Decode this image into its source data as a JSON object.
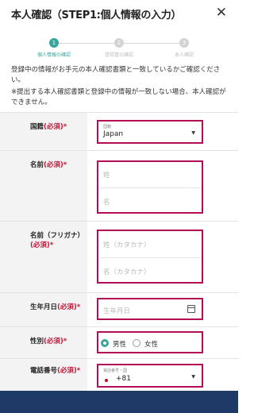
{
  "header": {
    "title": "本人確認（STEP1:個人情報の入力）",
    "close_icon": "close-icon"
  },
  "steps": [
    {
      "number": "1",
      "label": "個人情報の確認",
      "active": true
    },
    {
      "number": "2",
      "label": "登録書の確認",
      "active": false
    },
    {
      "number": "3",
      "label": "本人確認",
      "active": false
    }
  ],
  "notices": [
    "登録中の情報がお手元の本人確認書類と一致しているかご確認ください。",
    "※提出する本人確認書類と登録中の情報が一致しない場合、本人確認ができません。"
  ],
  "required_mark": "(必須)",
  "form": {
    "nationality": {
      "label": "国籍",
      "mini_label": "国籍",
      "value": "Japan"
    },
    "name": {
      "label": "名前",
      "last_placeholder": "姓",
      "first_placeholder": "名"
    },
    "kana": {
      "label": "名前（フリガナ）",
      "last_placeholder": "姓（カタカナ）",
      "first_placeholder": "名（カタカナ）"
    },
    "birthdate": {
      "label": "生年月日",
      "placeholder": "生年月日"
    },
    "gender": {
      "label": "性別",
      "options": [
        "男性",
        "女性"
      ],
      "selected": "男性"
    },
    "phone": {
      "label": "電話番号",
      "mini_label": "電話番号・国",
      "value": "+81"
    }
  },
  "colors": {
    "accent_teal": "#3aa59c",
    "highlight_border": "#b10e57",
    "required_red": "#c0183a",
    "footer_navy": "#1f3a66"
  }
}
